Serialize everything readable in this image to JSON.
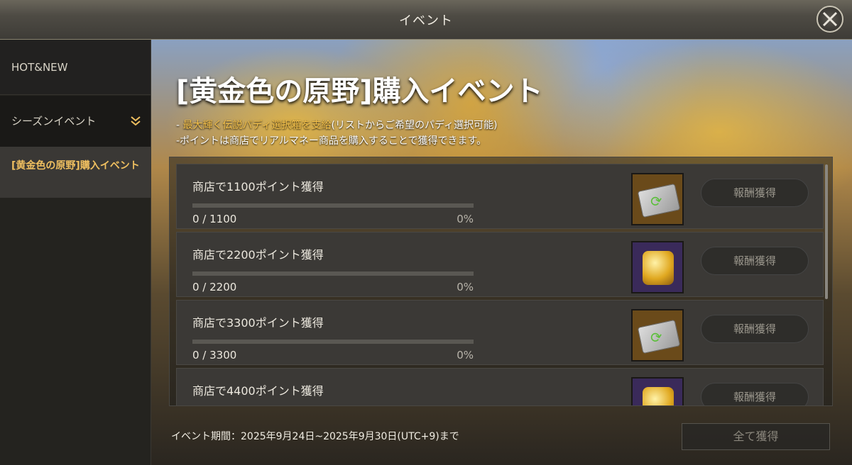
{
  "window": {
    "title": "イベント"
  },
  "sidebar": {
    "items": [
      {
        "label": "HOT&NEW"
      },
      {
        "label": "シーズンイベント"
      },
      {
        "label": "[黄金色の原野]購入イベント"
      }
    ]
  },
  "event": {
    "title": "[黄金色の原野]購入イベント",
    "desc1_prefix": "- ",
    "desc1_highlight": "最大輝く伝説パディ選択箱を支給",
    "desc1_suffix": "(リストからご希望のパディ選択可能)",
    "desc2": "-ポイントは商店でリアルマネー商品を購入することで獲得できます。"
  },
  "rows": [
    {
      "label": "商店で1100ポイント獲得",
      "progress_text": "0 / 1100",
      "percent_text": "0%",
      "progress": 0,
      "reward": "ticket-icon",
      "claim_label": "報酬獲得"
    },
    {
      "label": "商店で2200ポイント獲得",
      "progress_text": "0 / 2200",
      "percent_text": "0%",
      "progress": 0,
      "reward": "chest-icon",
      "claim_label": "報酬獲得"
    },
    {
      "label": "商店で3300ポイント獲得",
      "progress_text": "0 / 3300",
      "percent_text": "0%",
      "progress": 0,
      "reward": "ticket-icon",
      "claim_label": "報酬獲得"
    },
    {
      "label": "商店で4400ポイント獲得",
      "progress_text": "",
      "percent_text": "",
      "progress": 0,
      "reward": "chest-icon",
      "claim_label": "報酬獲得"
    }
  ],
  "footer": {
    "period": "イベント期間：2025年9月24日~2025年9月30日(UTC+9)まで",
    "claim_all_label": "全て獲得"
  },
  "colors": {
    "highlight": "#f5c14a",
    "selected_sidebar": "#f0c060"
  }
}
